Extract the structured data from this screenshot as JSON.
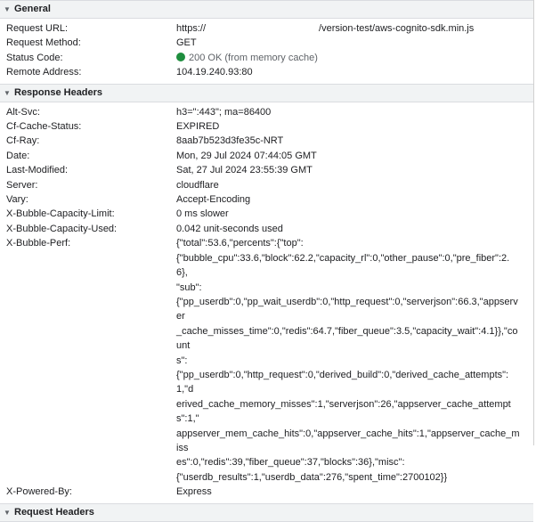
{
  "general": {
    "title": "General",
    "request_url_label": "Request URL:",
    "request_url_prefix": "https://",
    "request_url_path": "/version-test/aws-cognito-sdk.min.js",
    "request_method_label": "Request Method:",
    "request_method": "GET",
    "status_code_label": "Status Code:",
    "status_code": "200 OK (from memory cache)",
    "status_color": "#1e8e3e",
    "remote_address_label": "Remote Address:",
    "remote_address": "104.19.240.93:80"
  },
  "response_headers": {
    "title": "Response Headers",
    "alt_svc_label": "Alt-Svc:",
    "alt_svc": "h3=\":443\"; ma=86400",
    "cf_cache_status_label": "Cf-Cache-Status:",
    "cf_cache_status": "EXPIRED",
    "cf_ray_label": "Cf-Ray:",
    "cf_ray": "8aab7b523d3fe35c-NRT",
    "date_label": "Date:",
    "date": "Mon, 29 Jul 2024 07:44:05 GMT",
    "last_modified_label": "Last-Modified:",
    "last_modified": "Sat, 27 Jul 2024 23:55:39 GMT",
    "server_label": "Server:",
    "server": "cloudflare",
    "vary_label": "Vary:",
    "vary": "Accept-Encoding",
    "capacity_limit_label": "X-Bubble-Capacity-Limit:",
    "capacity_limit": "0 ms slower",
    "capacity_used_label": "X-Bubble-Capacity-Used:",
    "capacity_used": "0.042 unit-seconds used",
    "perf_label": "X-Bubble-Perf:",
    "perf_lines": [
      "{\"total\":53.6,\"percents\":{\"top\":",
      "{\"bubble_cpu\":33.6,\"block\":62.2,\"capacity_rl\":0,\"other_pause\":0,\"pre_fiber\":2.6},",
      "\"sub\":",
      "{\"pp_userdb\":0,\"pp_wait_userdb\":0,\"http_request\":0,\"serverjson\":66.3,\"appserver",
      "_cache_misses_time\":0,\"redis\":64.7,\"fiber_queue\":3.5,\"capacity_wait\":4.1}},\"count",
      "s\":",
      "{\"pp_userdb\":0,\"http_request\":0,\"derived_build\":0,\"derived_cache_attempts\":1,\"d",
      "erived_cache_memory_misses\":1,\"serverjson\":26,\"appserver_cache_attempts\":1,\"",
      "appserver_mem_cache_hits\":0,\"appserver_cache_hits\":1,\"appserver_cache_miss",
      "es\":0,\"redis\":39,\"fiber_queue\":37,\"blocks\":36},\"misc\":",
      "{\"userdb_results\":1,\"userdb_data\":276,\"spent_time\":2700102}}"
    ],
    "powered_by_label": "X-Powered-By:",
    "powered_by": "Express"
  },
  "request_headers": {
    "title": "Request Headers"
  }
}
